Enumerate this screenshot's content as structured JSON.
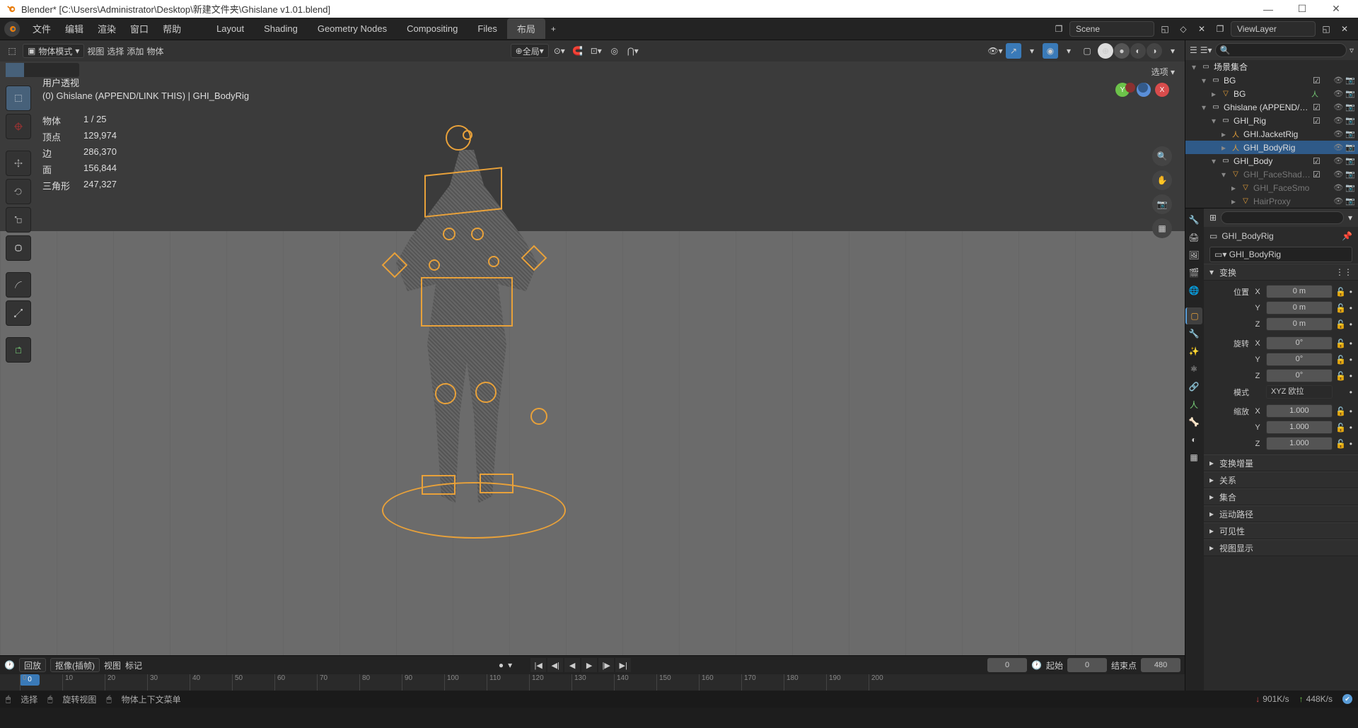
{
  "title": "Blender* [C:\\Users\\Administrator\\Desktop\\新建文件夹\\Ghislane v1.01.blend]",
  "topmenu": {
    "file": "文件",
    "edit": "编辑",
    "render": "渲染",
    "window": "窗口",
    "help": "帮助",
    "tabs": [
      "Layout",
      "Shading",
      "Geometry Nodes",
      "Compositing",
      "Files",
      "布局"
    ],
    "scene_label": "Scene",
    "viewlayer_label": "ViewLayer"
  },
  "vpheader": {
    "mode": "物体模式",
    "view": "视图",
    "select": "选择",
    "add": "添加",
    "object": "物体",
    "global": "全局"
  },
  "overlay": {
    "title": "用户透视",
    "sub": "(0) Ghislane (APPEND/LINK THIS) | GHI_BodyRig",
    "obj_l": "物体",
    "obj_v": "1 / 25",
    "vert_l": "顶点",
    "vert_v": "129,974",
    "edge_l": "边",
    "edge_v": "286,370",
    "face_l": "面",
    "face_v": "156,844",
    "tri_l": "三角形",
    "tri_v": "247,327",
    "options": "选项 ▾"
  },
  "outliner": {
    "scene": "场景集合",
    "rows": [
      {
        "d": 1,
        "tw": "▾",
        "i": "col",
        "l": "BG",
        "chk": true
      },
      {
        "d": 2,
        "tw": "▸",
        "i": "col-o",
        "l": "BG",
        "ex": "arm"
      },
      {
        "d": 1,
        "tw": "▾",
        "i": "col",
        "l": "Ghislane (APPEND/LINK T",
        "chk": true
      },
      {
        "d": 2,
        "tw": "▾",
        "i": "col",
        "l": "GHI_Rig",
        "chk": true
      },
      {
        "d": 3,
        "tw": "▸",
        "i": "arm-o",
        "l": "GHI.JacketRig"
      },
      {
        "d": 3,
        "tw": "▸",
        "i": "arm-o",
        "l": "GHI_BodyRig",
        "sel": true
      },
      {
        "d": 2,
        "tw": "▾",
        "i": "col",
        "l": "GHI_Body",
        "chk": true
      },
      {
        "d": 3,
        "tw": "▾",
        "i": "mesh-o",
        "l": "GHI_FaceShadow",
        "dim": true,
        "chk": true
      },
      {
        "d": 4,
        "tw": "▸",
        "i": "mesh-o",
        "l": "GHI_FaceSmo",
        "dim": true
      },
      {
        "d": 4,
        "tw": "▸",
        "i": "mesh-o",
        "l": "HairProxy",
        "dim": true
      }
    ]
  },
  "props": {
    "crumb": "GHI_BodyRig",
    "drop": "GHI_BodyRig",
    "transform": "变换",
    "pos": "位置",
    "rot": "旋转",
    "scale": "缩放",
    "mode_l": "模式",
    "mode_v": "XYZ 欧拉",
    "X": "X",
    "Y": "Y",
    "Z": "Z",
    "pos_x": "0 m",
    "pos_y": "0 m",
    "pos_z": "0 m",
    "rot_x": "0°",
    "rot_y": "0°",
    "rot_z": "0°",
    "scl_x": "1.000",
    "scl_y": "1.000",
    "scl_z": "1.000",
    "delta": "变换增量",
    "rel": "关系",
    "coll": "集合",
    "motion": "运动路径",
    "vis": "可见性",
    "disp": "视图显示"
  },
  "timeline": {
    "playback": "回放",
    "keying": "抠像(插帧)",
    "view": "视图",
    "marker": "标记",
    "start_l": "起始",
    "start_v": "0",
    "end_l": "结束点",
    "end_v": "480",
    "cur": "0",
    "marks": [
      "0",
      "10",
      "20",
      "30",
      "40",
      "50",
      "60",
      "70",
      "80",
      "90",
      "100",
      "110",
      "120",
      "130",
      "140",
      "150",
      "160",
      "170",
      "180",
      "190",
      "200"
    ]
  },
  "status": {
    "sel": "选择",
    "rot": "旋转视图",
    "ctx": "物体上下文菜单",
    "mem1": "901K/s",
    "mem2": "448K/s"
  }
}
